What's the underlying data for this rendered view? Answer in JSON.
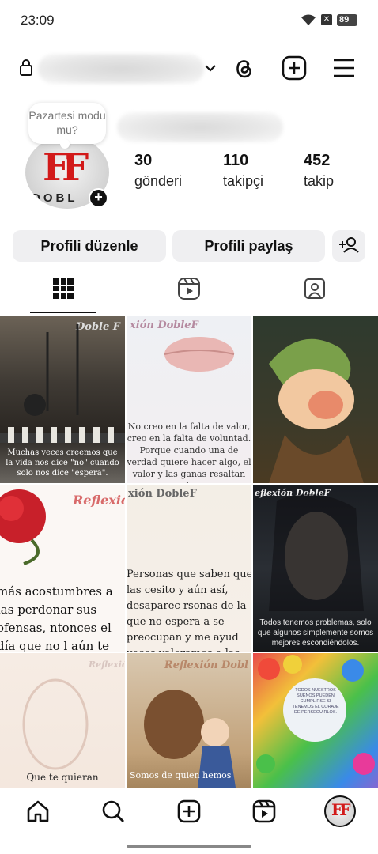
{
  "status_bar": {
    "time": "23:09",
    "battery": "89"
  },
  "profile": {
    "note": "Pazartesi modu mu?",
    "avatar_brand": "DOBL",
    "stats": [
      {
        "value": "30",
        "label": "gönderi"
      },
      {
        "value": "110",
        "label": "takipçi"
      },
      {
        "value": "452",
        "label": "takip"
      }
    ]
  },
  "buttons": {
    "edit": "Profili düzenle",
    "share": "Profili paylaş"
  },
  "tabs": [
    "grid-icon",
    "reels-icon",
    "tagged-icon"
  ],
  "posts": [
    {
      "brand": "Doble F",
      "caption": "Muchas veces creemos que la vida nos dice \"no\" cuando solo nos dice \"espera\"."
    },
    {
      "brand": "xión DobleF",
      "caption": "No creo en la falta de valor, creo en la falta de voluntad. Porque cuando una de verdad quiere hacer algo, el valor y las ganas resaltan solos."
    },
    {
      "brand": "",
      "caption": ""
    },
    {
      "brand": "Reflexió",
      "caption": "más acostumbres a las perdonar sus ofensas, ntonces el día que no l aún te echarán la cu"
    },
    {
      "brand": "xión DobleF",
      "caption": "Personas que saben que las cesito y aún así, desaparec rsonas de la que no espera a se preocupan y me ayud veces valoramos a las perso equivocadas."
    },
    {
      "brand": "eflexión DobleF",
      "caption": "Todos tenemos problemas, solo que algunos simplemente somos mejores escondiéndolos."
    },
    {
      "brand": "Reflexión",
      "caption": "Que te quieran"
    },
    {
      "brand": "Reflexión Dobl",
      "caption": "Somos de quien hemos"
    },
    {
      "brand": "",
      "caption": "TODOS NUESTROS SUEÑOS PUEDEN CUMPLIRSE SI TENEMOS EL CORAJE DE PERSEGUIRLOS."
    }
  ],
  "colors": {
    "brand_red": "#d21a1a",
    "button_bg": "#efeff1"
  }
}
